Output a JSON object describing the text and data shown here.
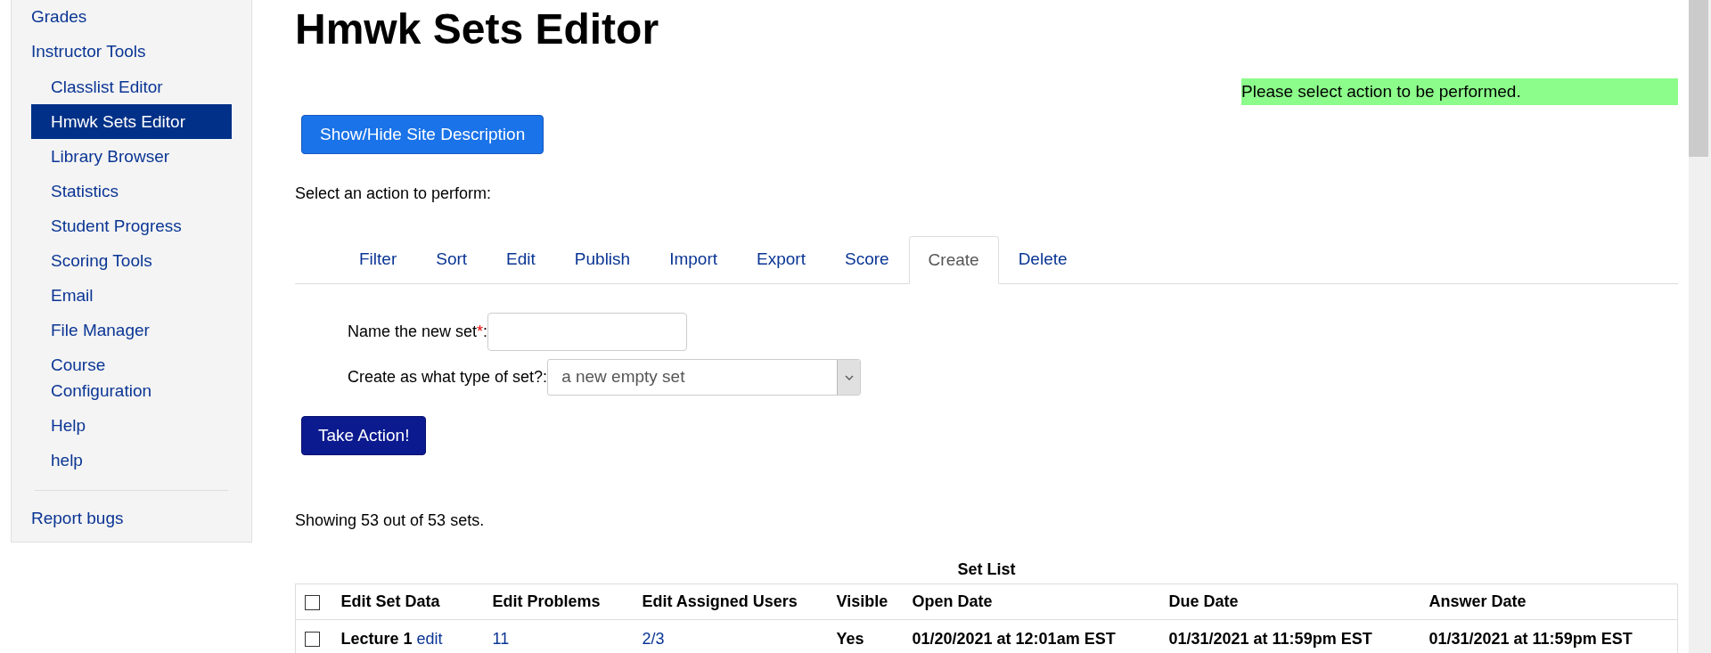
{
  "sidebar": {
    "items": [
      {
        "label": "Grades",
        "selected": false
      },
      {
        "label": "Instructor Tools",
        "selected": false,
        "children": [
          {
            "label": "Classlist Editor",
            "selected": false
          },
          {
            "label": "Hmwk Sets Editor",
            "selected": true
          },
          {
            "label": "Library Browser",
            "selected": false
          },
          {
            "label": "Statistics",
            "selected": false
          },
          {
            "label": "Student Progress",
            "selected": false
          },
          {
            "label": "Scoring Tools",
            "selected": false
          },
          {
            "label": "Email",
            "selected": false
          },
          {
            "label": "File Manager",
            "selected": false
          },
          {
            "label": "Course Configuration",
            "selected": false
          },
          {
            "label": "Help",
            "selected": false
          },
          {
            "label": "help",
            "selected": false
          }
        ]
      }
    ],
    "footer_link": "Report bugs"
  },
  "page_title": "Hmwk Sets Editor",
  "message": "Please select action to be performed.",
  "description_button": "Show/Hide Site Description",
  "action_prompt": "Select an action to perform:",
  "tabs": [
    {
      "label": "Filter",
      "selected": false
    },
    {
      "label": "Sort",
      "selected": false
    },
    {
      "label": "Edit",
      "selected": false
    },
    {
      "label": "Publish",
      "selected": false
    },
    {
      "label": "Import",
      "selected": false
    },
    {
      "label": "Export",
      "selected": false
    },
    {
      "label": "Score",
      "selected": false
    },
    {
      "label": "Create",
      "selected": true
    },
    {
      "label": "Delete",
      "selected": false
    }
  ],
  "form": {
    "name_label": "Name the new set",
    "required_mark": "*",
    "name_colon": ":",
    "type_label": "Create as what type of set?:",
    "type_value": "a new empty set"
  },
  "action_button": "Take Action!",
  "summary": "Showing 53 out of 53 sets.",
  "table": {
    "caption": "Set List",
    "header_checked": false,
    "columns": [
      "Edit Set Data",
      "Edit Problems",
      "Edit Assigned Users",
      "Visible",
      "Open Date",
      "Due Date",
      "Answer Date"
    ],
    "rows": [
      {
        "checked": false,
        "name": "Lecture 1",
        "edit_link": "edit",
        "problems": "11",
        "users": "2/3",
        "visible": "Yes",
        "open_date": "01/20/2021 at 12:01am EST",
        "due_date": "01/31/2021 at 11:59pm EST",
        "answer_date": "01/31/2021 at 11:59pm EST"
      }
    ]
  }
}
